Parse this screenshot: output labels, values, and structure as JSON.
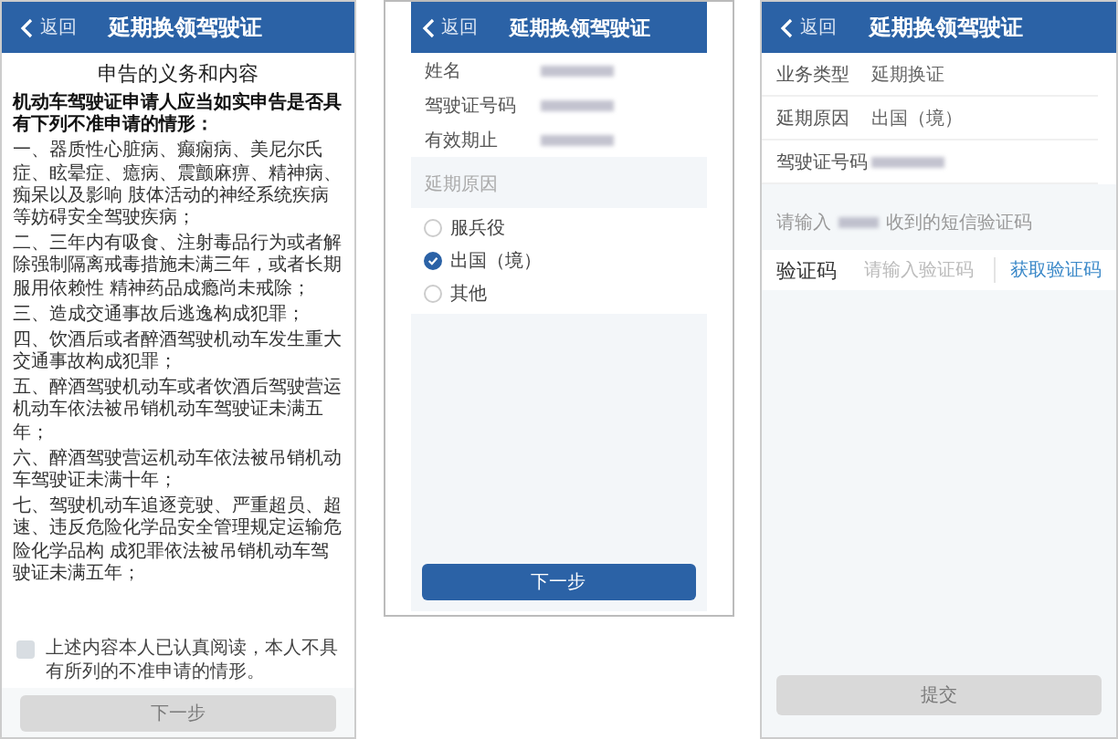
{
  "declaration_screen": {
    "header": {
      "back": "返回",
      "title": "延期换领驾驶证"
    },
    "heading": "申告的义务和内容",
    "intro": "机动车驾驶证申请人应当如实申告是否具有下列不准申请的情形：",
    "items": [
      "一、器质性心脏病、癫痫病、美尼尔氏症、眩晕症、癔病、震颤麻痹、精神病、痴呆以及影响 肢体活动的神经系统疾病等妨碍安全驾驶疾病；",
      "二、三年内有吸食、注射毒品行为或者解除强制隔离戒毒措施未满三年，或者长期服用依赖性 精神药品成瘾尚未戒除；",
      "三、造成交通事故后逃逸构成犯罪；",
      "四、饮酒后或者醉酒驾驶机动车发生重大交通事故构成犯罪；",
      "五、醉酒驾驶机动车或者饮酒后驾驶营运机动车依法被吊销机动车驾驶证未满五年；",
      "六、醉酒驾驶营运机动车依法被吊销机动车驾驶证未满十年；",
      "七、驾驶机动车追逐竞驶、严重超员、超速、违反危险化学品安全管理规定运输危险化学品构 成犯罪依法被吊销机动车驾驶证未满五年；"
    ],
    "agreement": {
      "label": "上述内容本人已认真阅读，本人不具有所列的不准申请的情形。",
      "checked": false
    },
    "next_button": {
      "label": "下一步",
      "disabled": true
    }
  },
  "reason_screen": {
    "header": {
      "back": "返回",
      "title": "延期换领驾驶证"
    },
    "fields": [
      {
        "label": "姓名"
      },
      {
        "label": "驾驶证号码"
      },
      {
        "label": "有效期止"
      }
    ],
    "section_label": "延期原因",
    "options": [
      {
        "label": "服兵役",
        "selected": false
      },
      {
        "label": "出国（境）",
        "selected": true
      },
      {
        "label": "其他",
        "selected": false
      }
    ],
    "next_button": {
      "label": "下一步",
      "disabled": false
    }
  },
  "confirm_screen": {
    "header": {
      "back": "返回",
      "title": "延期换领驾驶证"
    },
    "fields": [
      {
        "label": "业务类型",
        "value": "延期换证"
      },
      {
        "label": "延期原因",
        "value": "出国（境）"
      },
      {
        "label": "驾驶证号码"
      }
    ],
    "sms_hint_start": "请输入",
    "sms_hint_end": "收到的短信验证码",
    "code_field": {
      "label": "验证码",
      "placeholder": "请输入验证码",
      "action": "获取验证码"
    },
    "submit_button": {
      "label": "提交",
      "disabled": true
    }
  }
}
